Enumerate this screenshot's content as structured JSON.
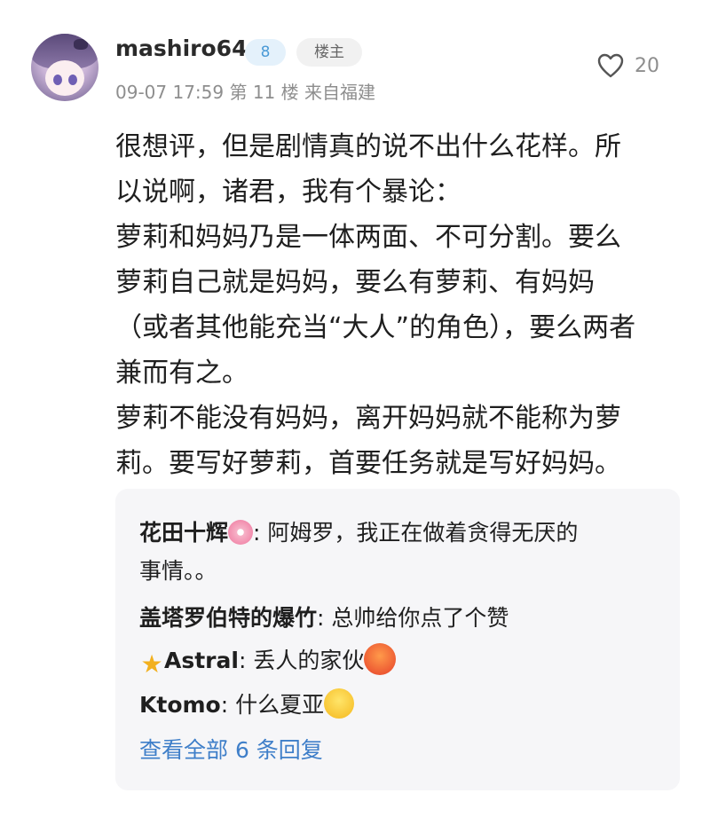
{
  "post": {
    "username": "mashiro64",
    "level": "8",
    "op_badge": "楼主",
    "meta": "09-07 17:59 第 11 楼 来自福建",
    "likes": "20",
    "content_lines": [
      "很想评，但是剧情真的说不出什么花样。所",
      "以说啊，诸君，我有个暴论：",
      "萝莉和妈妈乃是一体两面、不可分割。要么",
      "萝莉自己就是妈妈，要么有萝莉、有妈妈",
      "（或者其他能充当“大人”的角色），要么两者",
      "兼而有之。",
      "萝莉不能没有妈妈，离开妈妈就不能称为萝",
      "莉。要写好萝莉，首要任务就是写好妈妈。"
    ]
  },
  "replies": [
    {
      "name": "花田十辉",
      "emoji": "cherry-blossom-emoji",
      "text": ": 阿姆罗，我正在做着贪得无厌的",
      "text2": "事情。。"
    },
    {
      "name": "盖塔罗伯特的爆竹",
      "text": ": 总帅给你点了个赞"
    },
    {
      "name": "Astral",
      "emoji_before": "star-emoji",
      "text": ": 丢人的家伙",
      "emoji_after": "angry-face-emoji"
    },
    {
      "name": "Ktomo",
      "text": ": 什么夏亚",
      "emoji_after": "laughing-face-emoji"
    }
  ],
  "view_all": "查看全部 6 条回复",
  "colors": {
    "link": "#3f7fc9",
    "meta": "#8e8e8e",
    "reply_bg": "#f6f6f8"
  }
}
